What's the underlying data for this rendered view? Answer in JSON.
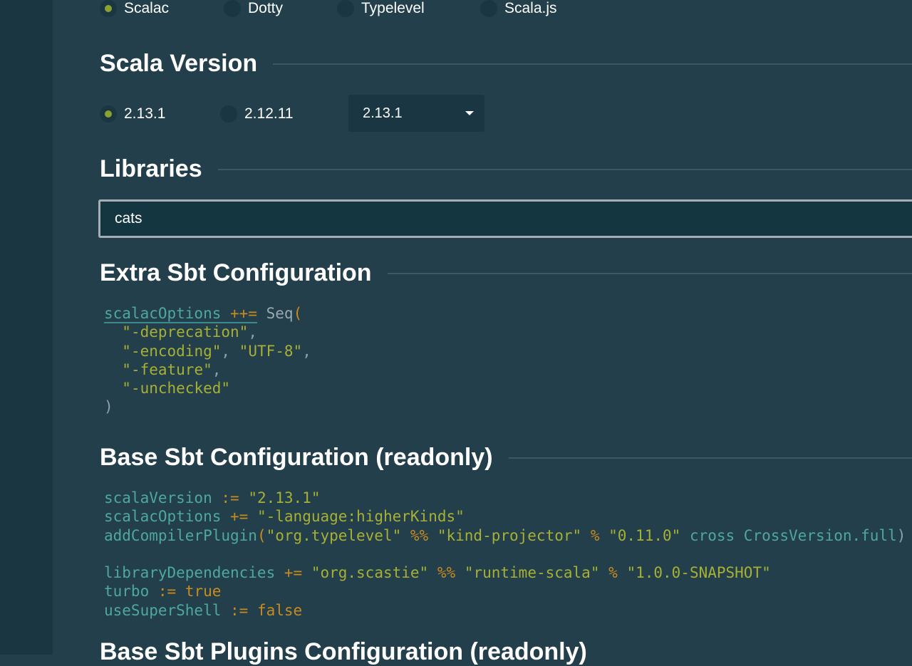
{
  "targets": [
    {
      "label": "Scalac",
      "checked": true
    },
    {
      "label": "Dotty",
      "checked": false
    },
    {
      "label": "Typelevel",
      "checked": false
    },
    {
      "label": "Scala.js",
      "checked": false
    }
  ],
  "scala_version": {
    "title": "Scala Version",
    "options": [
      {
        "label": "2.13.1",
        "checked": true
      },
      {
        "label": "2.12.11",
        "checked": false
      }
    ],
    "select_value": "2.13.1"
  },
  "libraries": {
    "title": "Libraries",
    "search_value": "cats"
  },
  "extra_sbt": {
    "title": "Extra Sbt Configuration",
    "lines": [
      "scalacOptions ++= Seq(",
      "  \"-deprecation\",",
      "  \"-encoding\", \"UTF-8\",",
      "  \"-feature\",",
      "  \"-unchecked\"",
      ")"
    ]
  },
  "base_sbt": {
    "title": "Base Sbt Configuration (readonly)",
    "lines": [
      "scalaVersion := \"2.13.1\"",
      "scalacOptions += \"-language:higherKinds\"",
      "addCompilerPlugin(\"org.typelevel\" %% \"kind-projector\" % \"0.11.0\" cross CrossVersion.full)",
      "",
      "libraryDependencies += \"org.scastie\" %% \"runtime-scala\" % \"1.0.0-SNAPSHOT\"",
      "turbo := true",
      "useSuperShell := false"
    ]
  },
  "next_section": {
    "title": "Base Sbt Plugins Configuration (readonly)"
  }
}
